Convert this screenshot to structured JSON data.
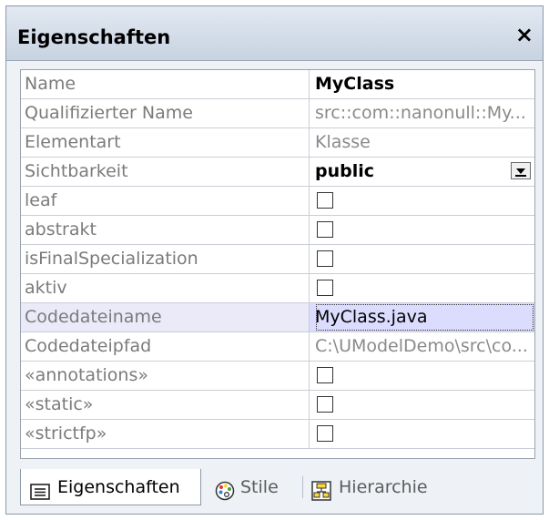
{
  "window": {
    "title": "Eigenschaften",
    "close_glyph": "×"
  },
  "properties": [
    {
      "name": "Name",
      "value": "MyClass",
      "kind": "text",
      "style": "bold"
    },
    {
      "name": "Qualifizierter Name",
      "value": "src::com::nanonull::My...",
      "kind": "text",
      "style": "grey"
    },
    {
      "name": "Elementart",
      "value": "Klasse",
      "kind": "text",
      "style": "grey"
    },
    {
      "name": "Sichtbarkeit",
      "value": "public",
      "kind": "dropdown",
      "style": "bold"
    },
    {
      "name": "leaf",
      "kind": "checkbox",
      "checked": false
    },
    {
      "name": "abstrakt",
      "kind": "checkbox",
      "checked": false
    },
    {
      "name": "isFinalSpecialization",
      "kind": "checkbox",
      "checked": false
    },
    {
      "name": "aktiv",
      "kind": "checkbox",
      "checked": false
    },
    {
      "name": "Codedateiname",
      "value": "MyClass.java",
      "kind": "text",
      "style": "selected"
    },
    {
      "name": "Codedateipfad",
      "value": "C:\\UModelDemo\\src\\co...",
      "kind": "text",
      "style": "grey"
    },
    {
      "name": "«annotations»",
      "kind": "checkbox",
      "checked": false
    },
    {
      "name": "«static»",
      "kind": "checkbox",
      "checked": false
    },
    {
      "name": "«strictfp»",
      "kind": "checkbox",
      "checked": false
    }
  ],
  "tabs": [
    {
      "label": "Eigenschaften",
      "icon": "properties-icon",
      "active": true
    },
    {
      "label": "Stile",
      "icon": "palette-icon",
      "active": false
    },
    {
      "label": "Hierarchie",
      "icon": "hierarchy-icon",
      "active": false
    }
  ]
}
